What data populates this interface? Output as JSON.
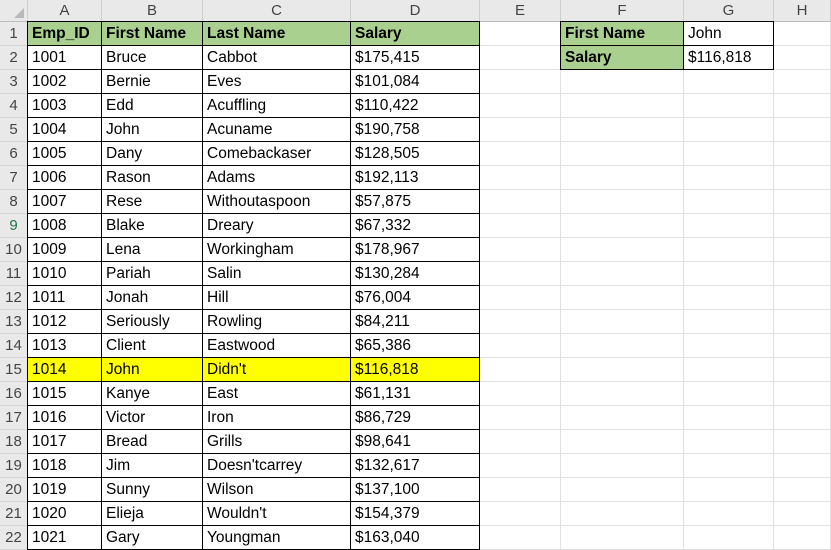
{
  "columns": [
    "A",
    "B",
    "C",
    "D",
    "E",
    "F",
    "G",
    "H"
  ],
  "rows": [
    "1",
    "2",
    "3",
    "4",
    "5",
    "6",
    "7",
    "8",
    "9",
    "10",
    "11",
    "12",
    "13",
    "14",
    "15",
    "16",
    "17",
    "18",
    "19",
    "20",
    "21",
    "22"
  ],
  "table": {
    "headers": [
      "Emp_ID",
      "First Name",
      "Last Name",
      "Salary"
    ],
    "data": [
      [
        "1001",
        "Bruce",
        "Cabbot",
        "$175,415"
      ],
      [
        "1002",
        "Bernie",
        "Eves",
        "$101,084"
      ],
      [
        "1003",
        "Edd",
        "Acuffling",
        "$110,422"
      ],
      [
        "1004",
        "John",
        "Acuname",
        "$190,758"
      ],
      [
        "1005",
        "Dany",
        "Comebackaser",
        "$128,505"
      ],
      [
        "1006",
        "Rason",
        "Adams",
        "$192,113"
      ],
      [
        "1007",
        "Rese",
        "Withoutaspoon",
        "$57,875"
      ],
      [
        "1008",
        "Blake",
        "Dreary",
        "$67,332"
      ],
      [
        "1009",
        "Lena",
        "Workingham",
        "$178,967"
      ],
      [
        "1010",
        "Pariah",
        "Salin",
        "$130,284"
      ],
      [
        "1011",
        "Jonah",
        "Hill",
        "$76,004"
      ],
      [
        "1012",
        "Seriously",
        "Rowling",
        "$84,211"
      ],
      [
        "1013",
        "Client",
        "Eastwood",
        "$65,386"
      ],
      [
        "1014",
        "John",
        "Didn't",
        "$116,818"
      ],
      [
        "1015",
        "Kanye",
        "East",
        "$61,131"
      ],
      [
        "1016",
        "Victor",
        "Iron",
        "$86,729"
      ],
      [
        "1017",
        "Bread",
        "Grills",
        "$98,641"
      ],
      [
        "1018",
        "Jim",
        "Doesn'tcarrey",
        "$132,617"
      ],
      [
        "1019",
        "Sunny",
        "Wilson",
        "$137,100"
      ],
      [
        "1020",
        "Elieja",
        "Wouldn't",
        "$154,379"
      ],
      [
        "1021",
        "Gary",
        "Youngman",
        "$163,040"
      ]
    ],
    "highlighted_row_index": 13
  },
  "lookup": {
    "first_name_label": "First Name",
    "first_name_value": "John",
    "salary_label": "Salary",
    "salary_value": "$116,818"
  },
  "colors": {
    "header_fill": "#a9d08e",
    "highlight_fill": "#ffff00"
  },
  "selected_row": "9"
}
